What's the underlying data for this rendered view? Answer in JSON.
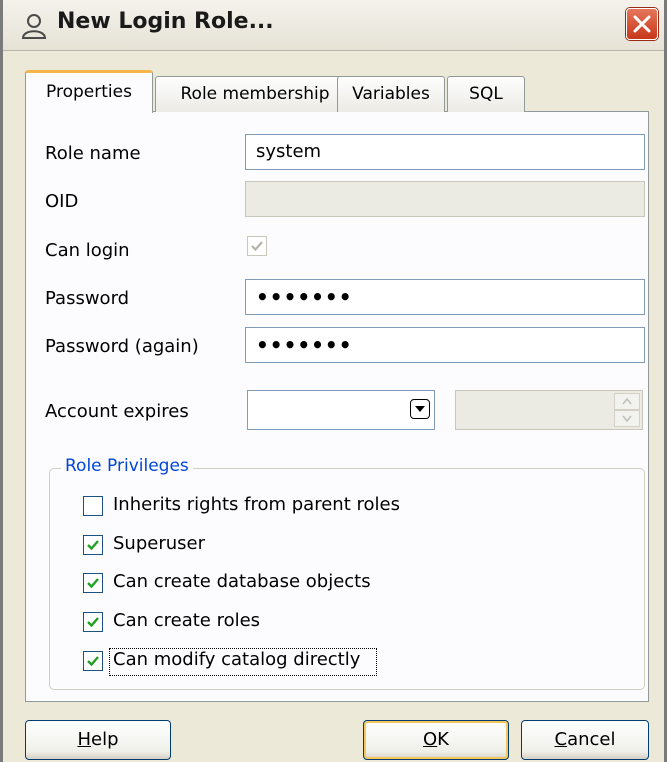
{
  "window": {
    "title": "New Login Role...",
    "icon": "user-icon"
  },
  "tabs": [
    {
      "label": "Properties",
      "active": true
    },
    {
      "label": "Role membership",
      "active": false
    },
    {
      "label": "Variables",
      "active": false
    },
    {
      "label": "SQL",
      "active": false
    }
  ],
  "form": {
    "role_name_label": "Role name",
    "role_name_value": "system",
    "oid_label": "OID",
    "oid_value": "",
    "can_login_label": "Can login",
    "can_login_checked": true,
    "password_label": "Password",
    "password_value": "•••••••",
    "password_again_label": "Password (again)",
    "password_again_value": "•••••••",
    "account_expires_label": "Account expires",
    "account_expires_date": "",
    "account_expires_time": ""
  },
  "privileges": {
    "title": "Role Privileges",
    "items": [
      {
        "label": "Inherits rights from parent roles",
        "checked": false
      },
      {
        "label": "Superuser",
        "checked": true
      },
      {
        "label": "Can create database objects",
        "checked": true
      },
      {
        "label": "Can create roles",
        "checked": true
      },
      {
        "label": "Can modify catalog directly",
        "checked": true
      }
    ]
  },
  "buttons": {
    "help_underline": "H",
    "help_rest": "elp",
    "ok_underline": "O",
    "ok_rest": "K",
    "cancel_underline": "C",
    "cancel_rest": "ancel"
  },
  "colors": {
    "accent": "#0046d5",
    "check": "#21a121",
    "tab_highlight": "#f7b64a"
  }
}
